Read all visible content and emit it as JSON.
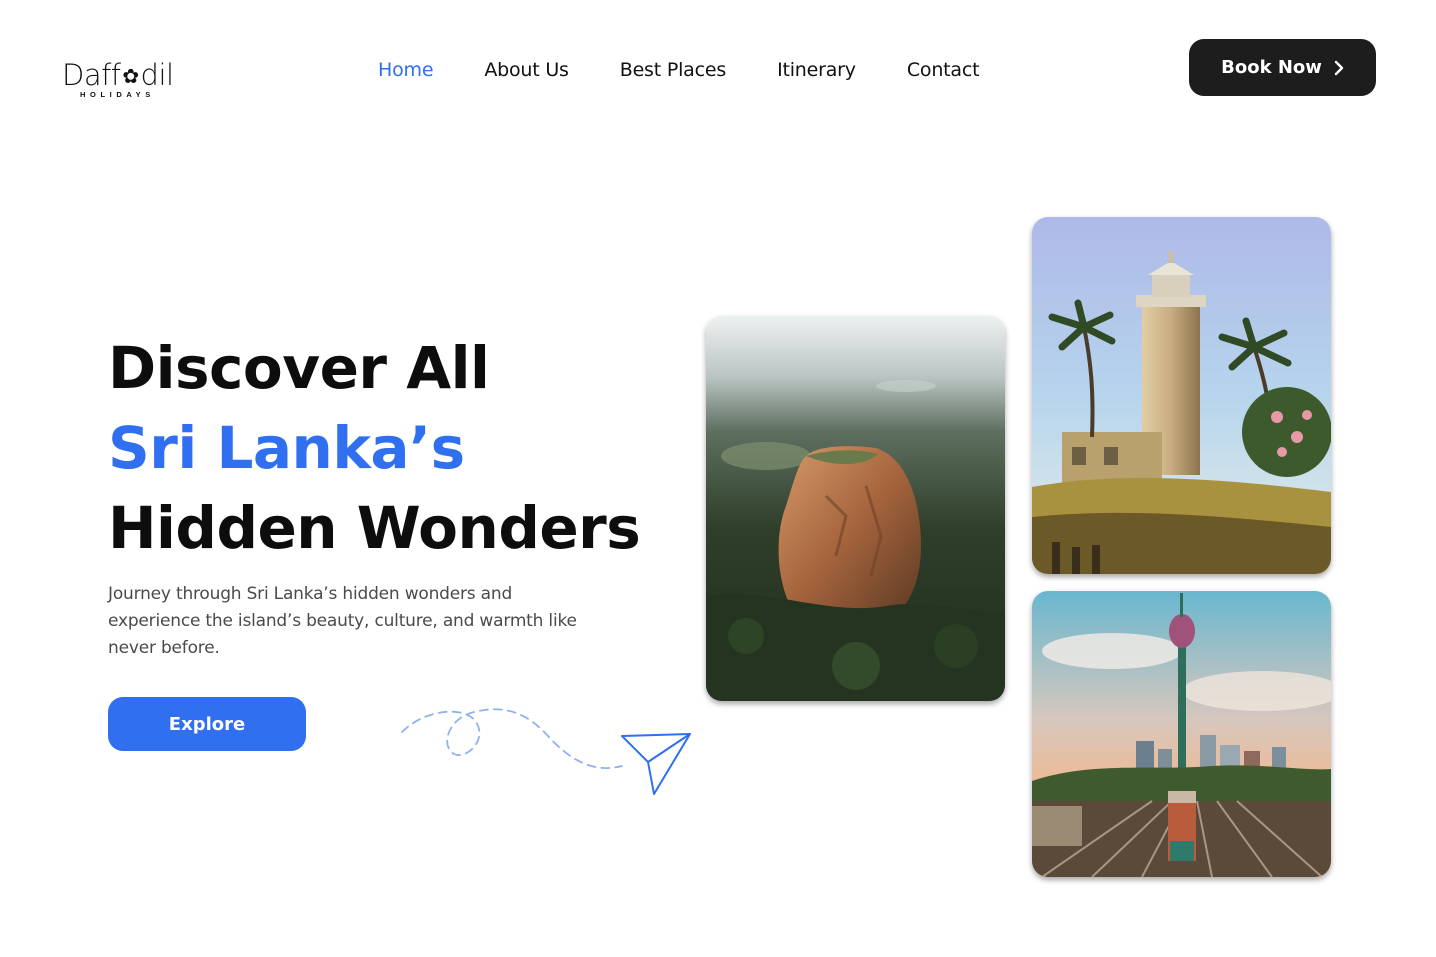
{
  "brand": {
    "name_before": "Daff",
    "name_after": "dil",
    "tagline": "HOLIDAYS",
    "flower_icon": "flower-icon"
  },
  "nav": {
    "items": [
      {
        "label": "Home",
        "active": true
      },
      {
        "label": "About Us",
        "active": false
      },
      {
        "label": "Best Places",
        "active": false
      },
      {
        "label": "Itinerary",
        "active": false
      },
      {
        "label": "Contact",
        "active": false
      }
    ]
  },
  "header": {
    "book_label": "Book Now",
    "book_icon": "chevron-right-icon"
  },
  "hero": {
    "line1": "Discover All",
    "line2": "Sri Lanka’s",
    "line3": "Hidden Wonders",
    "description": "Journey through Sri Lanka’s hidden wonders and experience the island’s beauty, culture, and warmth like never before.",
    "explore_label": "Explore"
  },
  "gallery": {
    "images": [
      {
        "subject": "aerial-rock-fortress"
      },
      {
        "subject": "lighthouse-with-palms"
      },
      {
        "subject": "city-tower-railway"
      }
    ]
  },
  "colors": {
    "accent": "#2f6ff0",
    "dark_button": "#1d1d1d",
    "text": "#0d0d0d",
    "muted_text": "#4a4a4a"
  }
}
